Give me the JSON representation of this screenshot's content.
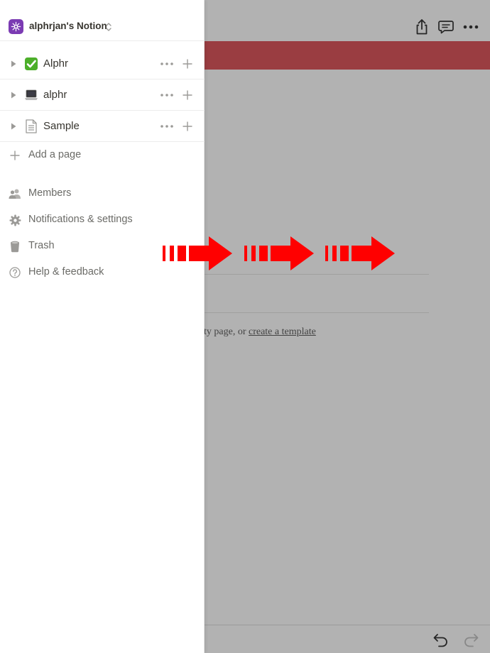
{
  "workspace": {
    "name": "alphrjan's Notion",
    "logo_icon": "notion-workspace-icon",
    "logo_color": "#7b3bb3"
  },
  "pages": [
    {
      "label": "Alphr",
      "icon": "check-mark-emoji-icon"
    },
    {
      "label": "alphr",
      "icon": "laptop-emoji-icon"
    },
    {
      "label": "Sample",
      "icon": "document-icon"
    }
  ],
  "add_page": {
    "label": "Add a page",
    "icon": "plus-icon"
  },
  "menu": [
    {
      "label": "Members",
      "icon": "members-icon"
    },
    {
      "label": "Notifications & settings",
      "icon": "gear-icon"
    },
    {
      "label": "Trash",
      "icon": "trash-icon"
    },
    {
      "label": "Help & feedback",
      "icon": "help-icon"
    }
  ],
  "background_page": {
    "hint_prefix": "pty page, or ",
    "hint_link": "create a template",
    "cover_color": "#d9474c"
  },
  "toolbar_icons": [
    "share-icon",
    "comment-icon",
    "more-icon"
  ],
  "bottom_icons": [
    "undo-icon",
    "redo-icon"
  ],
  "annotation": {
    "arrow_color": "#ff0000",
    "arrow_count": 3
  }
}
